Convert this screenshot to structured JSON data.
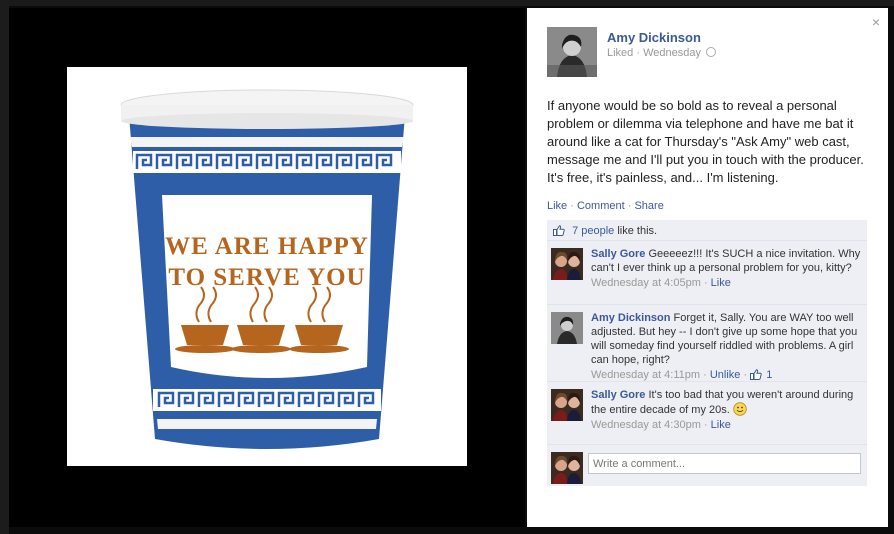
{
  "photo": {
    "cup_text_line1": "WE ARE HAPPY",
    "cup_text_line2": "TO SERVE YOU"
  },
  "panel": {
    "close_glyph": "×",
    "author": "Amy Dickinson",
    "meta_liked": "Liked",
    "meta_sep": "·",
    "meta_time": "Wednesday",
    "post_text": "If anyone would be so bold as to reveal a personal problem or dilemma via telephone and have me bat it around like a cat for Thursday's \"Ask Amy\" web cast, message me and I'll put you in touch with the producer. It's free, it's painless, and... I'm listening.",
    "actions": {
      "like": "Like",
      "comment": "Comment",
      "share": "Share",
      "sep": "·"
    },
    "likes": {
      "count_link": "7 people",
      "suffix": "like this."
    },
    "comments": [
      {
        "author": "Sally Gore",
        "text": "Geeeeez!!! It's SUCH a nice invitation. Why can't I ever think up a personal problem for you, kitty?",
        "time": "Wednesday at 4:05pm",
        "action": "Like",
        "like_count": ""
      },
      {
        "author": "Amy Dickinson",
        "text": "Forget it, Sally. You are WAY too well adjusted. But hey -- I don't give up some hope that you will someday find yourself riddled with problems. A girl can hope, right?",
        "time": "Wednesday at 4:11pm",
        "action": "Unlike",
        "like_count": "1"
      },
      {
        "author": "Sally Gore",
        "text": "It's too bad that you weren't around during the entire decade of my 20s.",
        "time": "Wednesday at 4:30pm",
        "action": "Like",
        "like_count": ""
      }
    ],
    "compose_placeholder": "Write a comment..."
  },
  "colors": {
    "link": "#3b5998",
    "ufi_bg": "#edeff4",
    "cup_blue": "#2f5ea8",
    "cup_brown": "#b5651d"
  },
  "icons": [
    "close-icon",
    "globe-icon",
    "thumbs-up-icon",
    "smiley-icon"
  ]
}
